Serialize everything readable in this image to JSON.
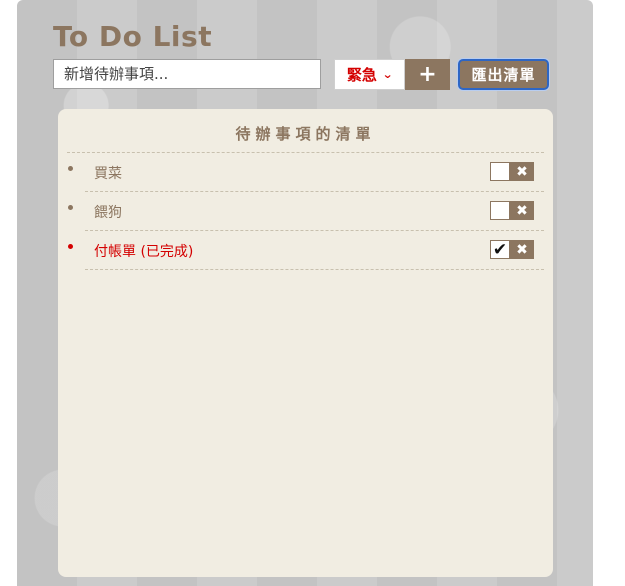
{
  "app": {
    "title": "To Do List",
    "input": {
      "placeholder": "新增待辦事項...",
      "value": ""
    },
    "priority": {
      "selected": "緊急"
    },
    "add_label": "+",
    "export_label": "匯出清單"
  },
  "panel": {
    "title": "待辦事項的清單",
    "items": [
      {
        "text": "買菜",
        "done": false
      },
      {
        "text": "餵狗",
        "done": false
      },
      {
        "text": "付帳單 (已完成)",
        "done": true
      }
    ],
    "check_mark": "✔",
    "delete_mark": "✖"
  },
  "colors": {
    "accent": "#8c7660",
    "urgent": "#d40000",
    "panel_bg": "#f1ede2",
    "focus_ring": "#2e66c4"
  },
  "icons": {
    "add": "plus-icon",
    "priority": "chevron-down-icon",
    "check": "checkmark-icon",
    "delete": "close-icon"
  }
}
